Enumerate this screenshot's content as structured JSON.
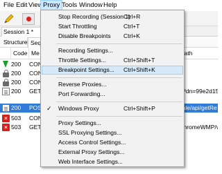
{
  "menubar": {
    "file": "File",
    "edit": "Edit",
    "view": "View",
    "proxy": "Proxy",
    "tools": "Tools",
    "window": "Window",
    "help": "Help"
  },
  "toolbar": {
    "edit_icon": "pencil-icon",
    "record_icon": "record-icon",
    "record_color": "#e02020"
  },
  "session_tab": "Session 1 *",
  "view_tabs": [
    "Structure",
    "Seq"
  ],
  "columns": {
    "code": "Code",
    "method": "Me",
    "path": "Path"
  },
  "rows": [
    {
      "icon": "down-arrow-icon",
      "code": "200",
      "method": "CON",
      "path": ""
    },
    {
      "icon": "lock-icon",
      "code": "200",
      "method": "CON",
      "path": ""
    },
    {
      "icon": "lock-icon",
      "code": "200",
      "method": "CON",
      "path": ""
    },
    {
      "icon": "document-icon",
      "code": "200",
      "method": "GET",
      "path": "/d?dn=99e2d15"
    },
    {
      "icon": "document-icon",
      "code": "200",
      "method": "POS",
      "path": "/sale/api/getRe",
      "selected": true
    },
    {
      "icon": "error-icon",
      "code": "503",
      "method": "CON",
      "path": ""
    },
    {
      "icon": "error-icon",
      "code": "503",
      "method": "GET",
      "path": "/ChromeWMP/v"
    }
  ],
  "menu": {
    "items": [
      {
        "label": "Stop Recording (Session 1)",
        "shortcut": "Ctrl+R"
      },
      {
        "label": "Start Throttling",
        "shortcut": "Ctrl+T"
      },
      {
        "label": "Disable Breakpoints",
        "shortcut": "Ctrl+K"
      },
      {
        "label": "Recording Settings...",
        "shortcut": ""
      },
      {
        "label": "Throttle Settings...",
        "shortcut": "Ctrl+Shift+T"
      },
      {
        "label": "Breakpoint Settings...",
        "shortcut": "Ctrl+Shift+K",
        "highlighted": true
      },
      {
        "label": "Reverse Proxies...",
        "shortcut": ""
      },
      {
        "label": "Port Forwarding...",
        "shortcut": ""
      },
      {
        "label": "Windows Proxy",
        "shortcut": "Ctrl+Shift+P",
        "checked": true
      },
      {
        "label": "Proxy Settings...",
        "shortcut": ""
      },
      {
        "label": "SSL Proxying Settings...",
        "shortcut": ""
      },
      {
        "label": "Access Control Settings...",
        "shortcut": ""
      },
      {
        "label": "External Proxy Settings...",
        "shortcut": ""
      },
      {
        "label": "Web Interface Settings...",
        "shortcut": ""
      }
    ],
    "check_glyph": "✓"
  }
}
